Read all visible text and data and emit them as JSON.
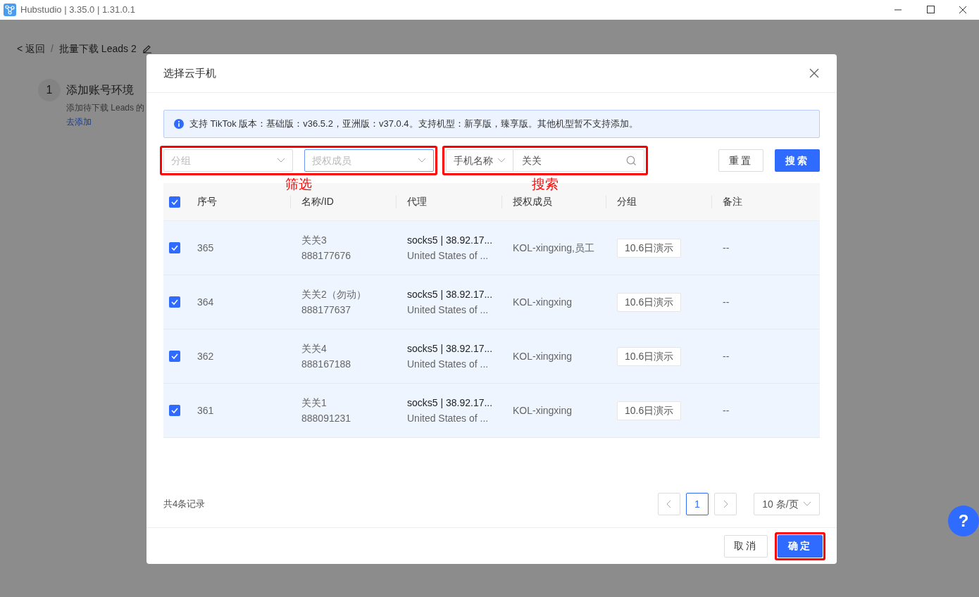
{
  "window": {
    "title": "Hubstudio | 3.35.0 | 1.31.0.1"
  },
  "page": {
    "back": "< 返回",
    "separator": "/",
    "title": "批量下载 Leads 2",
    "step": {
      "number": "1",
      "title": "添加账号环境",
      "description": "添加待下载 Leads 的",
      "link": "去添加"
    }
  },
  "dialog": {
    "title": "选择云手机",
    "notice": "支持 TikTok 版本：基础版：v36.5.2，亚洲版：v37.0.4。支持机型：新享版，臻享版。其他机型暂不支持添加。",
    "filters": [
      {
        "placeholder": "分组",
        "focused": false
      },
      {
        "placeholder": "授权成员",
        "focused": true
      }
    ],
    "search": {
      "field": "手机名称",
      "value": "关关"
    },
    "reset_button": "重置",
    "search_button": "搜索",
    "annotations": [
      "筛选",
      "搜索"
    ],
    "table": {
      "all_checked": true,
      "columns": [
        "序号",
        "名称/ID",
        "代理",
        "授权成员",
        "分组",
        "备注"
      ],
      "rows": [
        {
          "checked": true,
          "number": "365",
          "name": "关关3",
          "id": "888177676",
          "proxy": "socks5 | 38.92.17...",
          "location": "United States of ...",
          "members": "KOL-xingxing,员工",
          "group": "10.6日演示",
          "note": "--"
        },
        {
          "checked": true,
          "number": "364",
          "name": "关关2（勿动）",
          "id": "888177637",
          "proxy": "socks5 | 38.92.17...",
          "location": "United States of ...",
          "members": "KOL-xingxing",
          "group": "10.6日演示",
          "note": "--"
        },
        {
          "checked": true,
          "number": "362",
          "name": "关关4",
          "id": "888167188",
          "proxy": "socks5 | 38.92.17...",
          "location": "United States of ...",
          "members": "KOL-xingxing",
          "group": "10.6日演示",
          "note": "--"
        },
        {
          "checked": true,
          "number": "361",
          "name": "关关1",
          "id": "888091231",
          "proxy": "socks5 | 38.92.17...",
          "location": "United States of ...",
          "members": "KOL-xingxing",
          "group": "10.6日演示",
          "note": "--"
        }
      ]
    },
    "pagination": {
      "total": "共4条记录",
      "pages": [
        {
          "label": "1",
          "selected": true
        }
      ],
      "page_size": "10 条/页"
    },
    "cancel_button": "取消",
    "confirm_button": "确定"
  },
  "help": "?"
}
